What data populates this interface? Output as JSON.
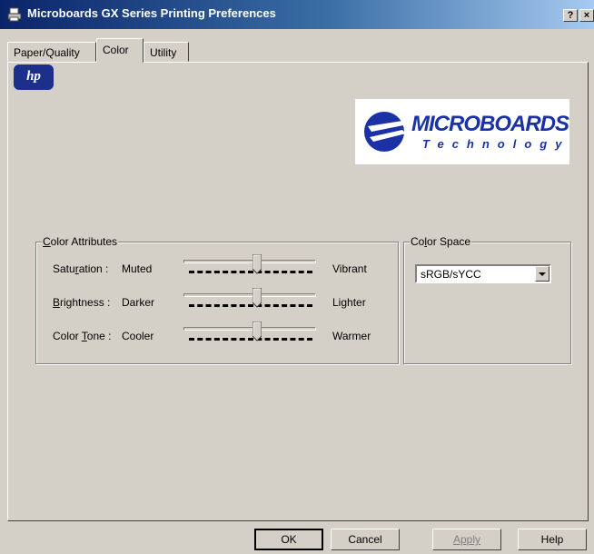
{
  "window": {
    "title": "Microboards GX Series Printing Preferences",
    "help_glyph": "?",
    "close_glyph": "×"
  },
  "tabs": [
    {
      "label": "Paper/Quality",
      "active": false
    },
    {
      "label": "Color",
      "active": true
    },
    {
      "label": "Utility",
      "active": false
    }
  ],
  "logos": {
    "hp_text": "hp",
    "brand_word": "MICROBOARDS",
    "brand_sub": "Technology"
  },
  "color_attributes": {
    "title_prefix": "C",
    "title_rest": "olor Attributes",
    "rows": [
      {
        "label_pre": "Satu",
        "label_u": "r",
        "label_post": "ation :",
        "left": "Muted",
        "right": "Vibrant",
        "level": 0.5
      },
      {
        "label_pre": "",
        "label_u": "B",
        "label_post": "rightness :",
        "left": "Darker",
        "right": "Lighter",
        "level": 0.5
      },
      {
        "label_pre": "Color ",
        "label_u": "T",
        "label_post": "one :",
        "left": "Cooler",
        "right": "Warmer",
        "level": 0.5
      }
    ]
  },
  "color_space": {
    "title_pre": "Co",
    "title_u": "l",
    "title_post": "or Space",
    "value": "sRGB/sYCC"
  },
  "buttons": {
    "ok": "OK",
    "cancel": "Cancel",
    "apply": "Apply",
    "help": "Help"
  },
  "colors": {
    "dialog_bg": "#d4d0c8",
    "brand_blue": "#1a32a5",
    "title_dark": "#0a246a"
  }
}
